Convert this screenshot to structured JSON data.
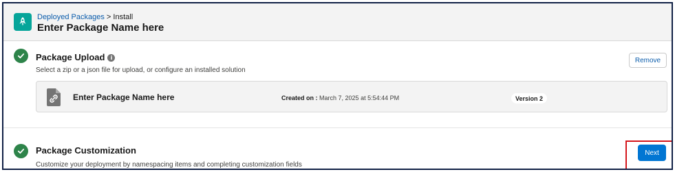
{
  "header": {
    "breadcrumb_link": "Deployed Packages",
    "breadcrumb_sep": ">",
    "breadcrumb_current": "Install",
    "title": "Enter Package Name here",
    "icon": "rocket-icon"
  },
  "upload_section": {
    "title": "Package Upload",
    "info_glyph": "i",
    "description": "Select a zip or a json file for upload, or configure an installed solution",
    "remove_label": "Remove",
    "status_icon": "check-icon"
  },
  "package_card": {
    "name": "Enter Package Name here",
    "created_label": "Created on :",
    "created_value": "March 7, 2025 at 5:54:44 PM",
    "version": "Version 2",
    "icon": "file-link-icon"
  },
  "customization_section": {
    "title": "Package Customization",
    "description": "Customize your deployment by namespacing items and completing customization fields",
    "next_label": "Next",
    "status_icon": "check-icon"
  },
  "colors": {
    "success": "#2e844a",
    "brand": "#0176d3",
    "link": "#0b5cab",
    "app_icon": "#06a59a",
    "highlight": "#d4151b"
  }
}
